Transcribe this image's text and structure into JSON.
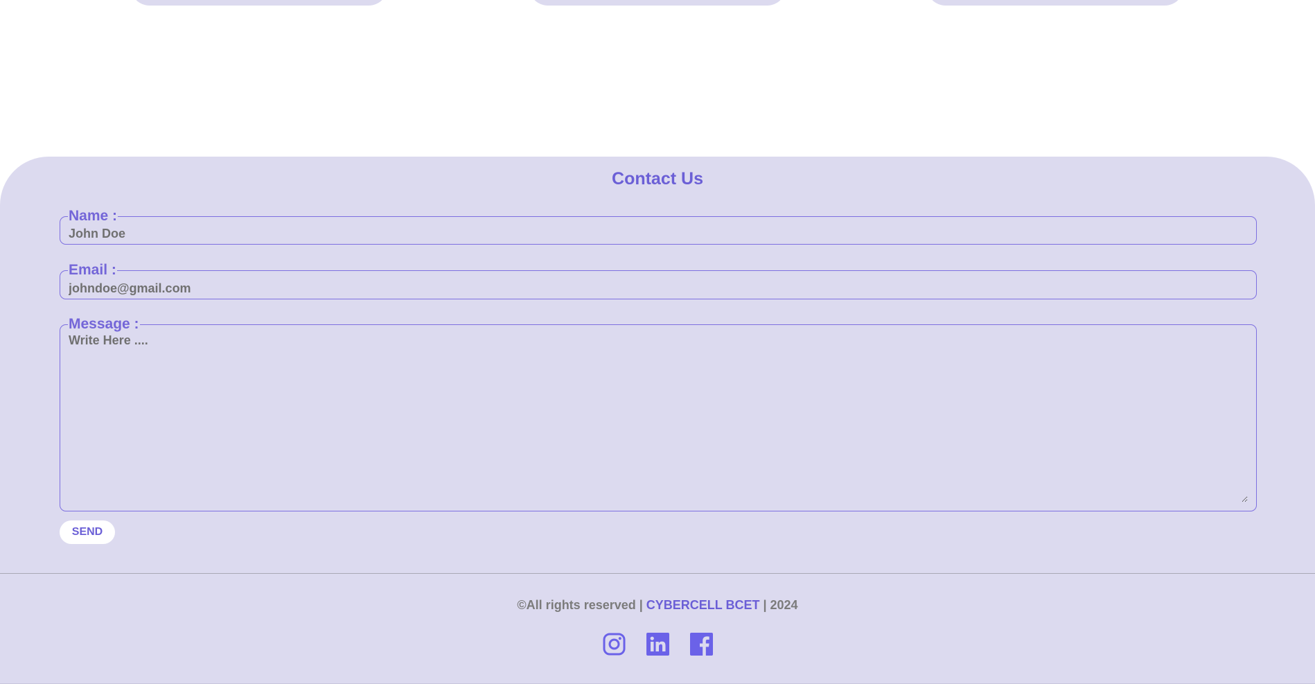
{
  "contact": {
    "title": "Contact Us",
    "name": {
      "label": "Name :",
      "placeholder": "John Doe"
    },
    "email": {
      "label": "Email :",
      "placeholder": "johndoe@gmail.com"
    },
    "message": {
      "label": "Message :",
      "placeholder": "Write Here ...."
    },
    "send_label": "SEND"
  },
  "footer": {
    "copyright_prefix": "©All rights reserved | ",
    "brand": "CYBERCELL BCET",
    "copyright_suffix": " | 2024",
    "social": [
      {
        "icon": "instagram-icon"
      },
      {
        "icon": "linkedin-icon"
      },
      {
        "icon": "facebook-icon"
      }
    ]
  },
  "colors": {
    "accent": "#6b5fd6",
    "section_bg": "#dcdaef",
    "icon": "#6b62e8",
    "text_muted": "#7b7b7b"
  }
}
